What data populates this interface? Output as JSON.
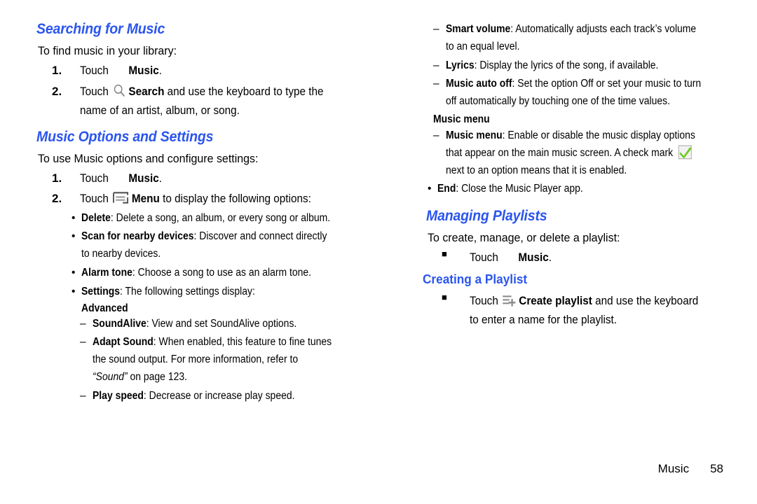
{
  "footer": {
    "label": "Music",
    "page_number": "58"
  },
  "colors": {
    "heading_blue": "#2b55ee",
    "check_green": "#7ed321",
    "icon_gray": "#808080"
  },
  "left_column": {
    "section1": {
      "heading": "Searching for Music",
      "lead": "To find music in your library:",
      "steps": [
        {
          "marker": "1.",
          "pre": "Touch ",
          "icon": "music-icon",
          "bold": "Music",
          "post": "."
        },
        {
          "marker": "2.",
          "pre": "Touch ",
          "icon": "search-icon",
          "bold": "Search",
          "post": " and use the keyboard to type the name of an artist, album, or song."
        }
      ]
    },
    "section2": {
      "heading": "Music Options and Settings",
      "lead": "To use Music options and configure settings:",
      "steps": [
        {
          "marker": "1.",
          "pre": "Touch ",
          "icon": "music-icon",
          "bold": "Music",
          "post": "."
        },
        {
          "marker": "2.",
          "pre": "Touch ",
          "icon": "menu-icon",
          "bold": "Menu",
          "post": " to display the following options:"
        }
      ],
      "options": [
        {
          "marker": "•",
          "bold": "Delete",
          "text": ": Delete a song, an album, or every song or album."
        },
        {
          "marker": "•",
          "bold": "Scan for nearby devices",
          "text": ": Discover and connect directly to nearby devices."
        },
        {
          "marker": "•",
          "bold": "Alarm tone",
          "text": ": Choose a song to use as an alarm tone."
        },
        {
          "marker": "•",
          "bold": "Settings",
          "text": ": The following settings display:"
        }
      ],
      "advanced_heading": "Advanced",
      "advanced_items": [
        {
          "marker": "–",
          "bold": "SoundAlive",
          "text": ": View and set SoundAlive options."
        },
        {
          "marker": "–",
          "bold": "Adapt Sound",
          "text": ": When enabled, this feature to fine tunes the sound output. For more information, refer to ",
          "italic": "“Sound”",
          "text2": " on page 123."
        },
        {
          "marker": "–",
          "bold": "Play speed",
          "text": ": Decrease or increase play speed."
        }
      ]
    }
  },
  "right_column": {
    "continued_items": [
      {
        "marker": "–",
        "bold": "Smart volume",
        "text": ": Automatically adjusts each track’s volume to an equal level."
      },
      {
        "marker": "–",
        "bold": "Lyrics",
        "text": ": Display the lyrics of the song, if available."
      },
      {
        "marker": "–",
        "bold": "Music auto off",
        "text": ": Set the option Off or set your music to turn off automatically by touching one of the time values."
      }
    ],
    "music_menu_heading": "Music menu",
    "music_menu_item": {
      "marker": "–",
      "bold": "Music menu",
      "text": ": Enable or disable the music display options that appear on the main music screen. A check mark ",
      "icon": "check-mark-icon",
      "text2": " next to an option means that it is enabled."
    },
    "end_item": {
      "marker": "•",
      "bold": "End",
      "text": ": Close the Music Player app."
    },
    "section3": {
      "heading": "Managing Playlists",
      "lead": "To create, manage, or delete a playlist:",
      "step": {
        "marker": "■",
        "pre": "Touch ",
        "icon": "music-icon",
        "bold": "Music",
        "post": "."
      }
    },
    "section4": {
      "heading": "Creating a Playlist",
      "step": {
        "marker": "■",
        "pre": "Touch ",
        "icon": "create-playlist-icon",
        "bold": "Create playlist",
        "post": " and use the keyboard to enter a name for the playlist."
      }
    }
  }
}
